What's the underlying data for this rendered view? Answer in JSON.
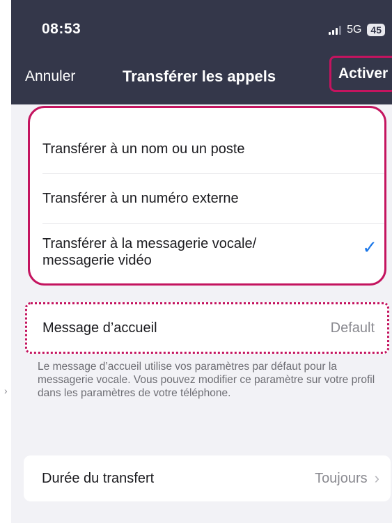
{
  "status_bar": {
    "time": "08:53",
    "network": "5G",
    "battery": "45"
  },
  "nav": {
    "cancel_label": "Annuler",
    "title": "Transférer les appels",
    "activate_label": "Activer"
  },
  "options": [
    {
      "label": "Transférer à un nom ou un poste",
      "selected": false
    },
    {
      "label": "Transférer à un numéro externe",
      "selected": false
    },
    {
      "label": "Transférer à la messagerie vocale/ messagerie vidéo",
      "selected": true
    }
  ],
  "check_icon": "checkmark-icon",
  "greeting": {
    "label": "Message d’accueil",
    "value": "Default"
  },
  "note": "Le message d’accueil utilise vos paramètres par défaut pour la messagerie vocale. Vous pouvez modifier ce paramètre sur votre profil dans les paramètres de votre téléphone.",
  "duration": {
    "label": "Durée du transfert",
    "value": "Toujours"
  },
  "colors": {
    "header_bg": "#34374a",
    "highlight": "#c4145f",
    "accent_check": "#1a76e8",
    "background": "#f2f2f6"
  }
}
